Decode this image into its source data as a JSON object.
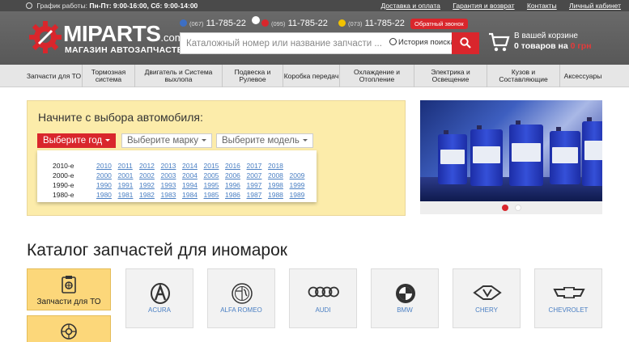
{
  "topbar": {
    "hours_label": "График работы:",
    "hours_value": "Пн-Пт: 9:00-16:00, Сб: 9:00-14:00",
    "links": [
      "Доставка и оплата",
      "Гарантия и возврат",
      "Контакты",
      "Личный кабинет"
    ]
  },
  "header": {
    "logo_main": "MIPARTS",
    "logo_domain": ".com.ua",
    "logo_sub": "МАГАЗИН АВТОЗАПЧАСТЕЙ",
    "phones": [
      {
        "code": "(067)",
        "number": "11-785-22",
        "icon": "kyivstar-icon",
        "color": "#3d6fc4"
      },
      {
        "code": "(095)",
        "number": "11-785-22",
        "icon": "vodafone-icon",
        "color": "#d9262c"
      },
      {
        "code": "(073)",
        "number": "11-785-22",
        "icon": "lifecell-icon",
        "color": "#f2c200"
      }
    ],
    "callback_label": "Обратный звонок",
    "search_placeholder": "Каталожный номер или название запчасти ...",
    "history_label": "История поиска",
    "cart_line1": "В вашей корзине",
    "cart_count": "0 товаров",
    "cart_on": "на",
    "cart_sum": "0 грн"
  },
  "nav": [
    "Запчасти для ТО",
    "Тормозная система",
    "Двигатель и Система выхлопа",
    "Подвеска и Рулевое",
    "Коробка передач",
    "Охлаждение и Отопление",
    "Электрика и Освещение",
    "Кузов и Составляющие",
    "Аксессуары"
  ],
  "selector": {
    "title": "Начните с выбора автомобиля:",
    "year_label": "Выберите год",
    "brand_label": "Выберите марку",
    "model_label": "Выберите модель",
    "decades": [
      {
        "label": "2010-е",
        "years": [
          "2010",
          "2011",
          "2012",
          "2013",
          "2014",
          "2015",
          "2016",
          "2017",
          "2018"
        ]
      },
      {
        "label": "2000-е",
        "years": [
          "2000",
          "2001",
          "2002",
          "2003",
          "2004",
          "2005",
          "2006",
          "2007",
          "2008",
          "2009"
        ]
      },
      {
        "label": "1990-е",
        "years": [
          "1990",
          "1991",
          "1992",
          "1993",
          "1994",
          "1995",
          "1996",
          "1997",
          "1998",
          "1999"
        ]
      },
      {
        "label": "1980-е",
        "years": [
          "1980",
          "1981",
          "1982",
          "1983",
          "1984",
          "1985",
          "1986",
          "1987",
          "1988",
          "1989"
        ]
      }
    ]
  },
  "banner": {
    "slides": 2,
    "active_slide": 1,
    "dot_active_color": "#d9262c",
    "dot_inactive_color": "#ffffff"
  },
  "catalog": {
    "title": "Каталог запчастей для иномарок",
    "side_tiles": [
      "Запчасти для ТО",
      ""
    ],
    "brands": [
      "Acura",
      "Alfa Romeo",
      "Audi",
      "BMW",
      "Chery",
      "Chevrolet"
    ]
  },
  "colors": {
    "accent": "#d9262c",
    "link": "#4a7fc3",
    "panel": "#fcecaa",
    "tile": "#fcd77a"
  }
}
